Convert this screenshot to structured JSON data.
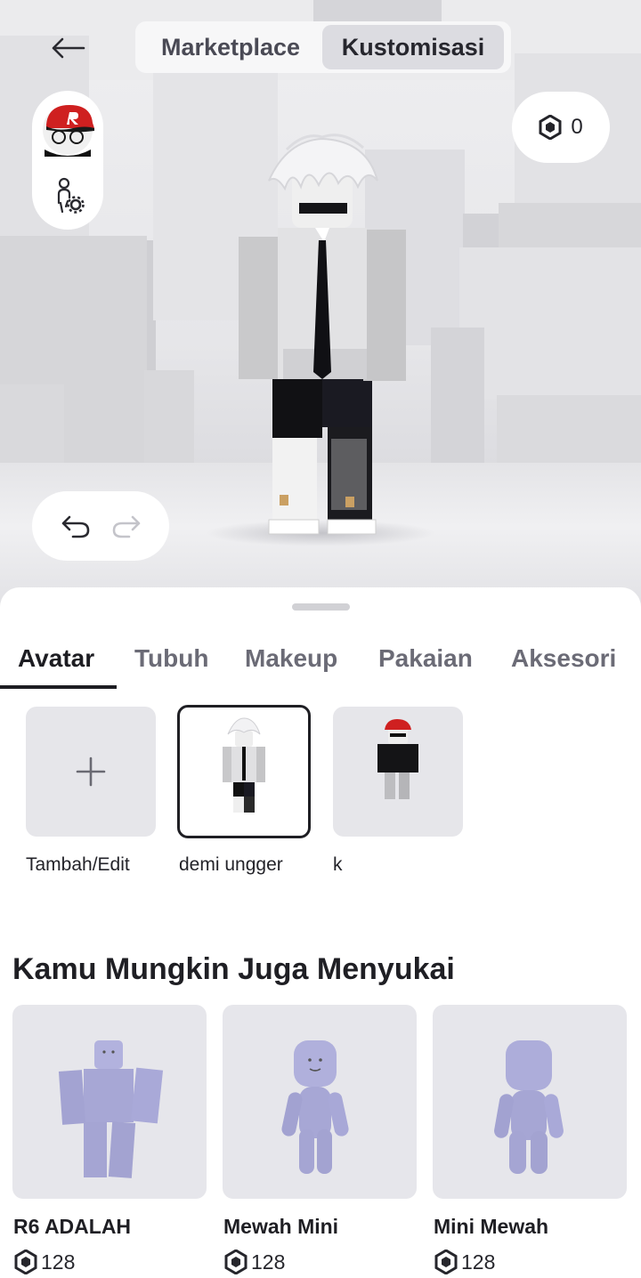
{
  "header": {
    "back_icon": "arrow-left-icon",
    "segments": [
      {
        "label": "Marketplace",
        "active": false
      },
      {
        "label": "Kustomisasi",
        "active": true
      }
    ]
  },
  "robux": {
    "icon": "robux-icon",
    "balance": "0"
  },
  "side_controls": {
    "avatar_icon": "avatar-headshot",
    "settings_icon": "body-settings-icon"
  },
  "history": {
    "undo_icon": "undo-icon",
    "redo_icon": "redo-icon",
    "redo_enabled": false
  },
  "tabs": [
    "Avatar",
    "Tubuh",
    "Makeup",
    "Pakaian",
    "Aksesori"
  ],
  "active_tab": "Avatar",
  "outfits": [
    {
      "label": "Tambah/Edit",
      "icon": "plus-icon"
    },
    {
      "label": "demi ungger",
      "selected": true
    },
    {
      "label": "k"
    }
  ],
  "recommendations": {
    "title": "Kamu Mungkin Juga Menyukai",
    "items": [
      {
        "name": "R6 ADALAH",
        "price": "128"
      },
      {
        "name": "Mewah Mini",
        "price": "128"
      },
      {
        "name": "Mini Mewah",
        "price": "128"
      }
    ]
  },
  "colors": {
    "accent": "#1d1d22",
    "tile_bg": "#e6e6ea",
    "mannequin": "#a9a9d6"
  }
}
